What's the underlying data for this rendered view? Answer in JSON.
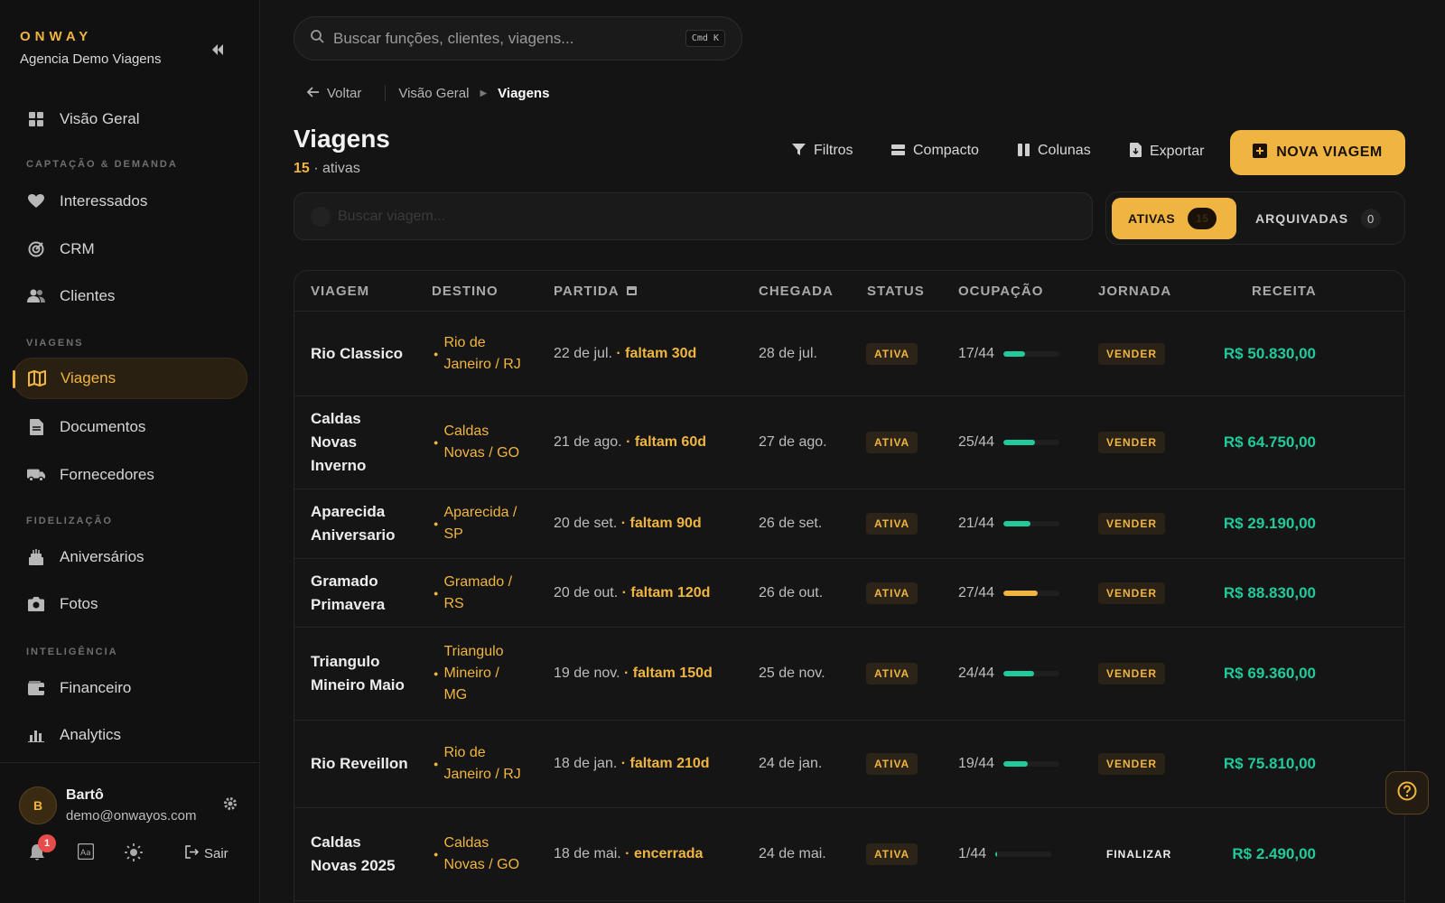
{
  "brand": {
    "name": "ONWAY",
    "agency": "Agencia Demo Viagens"
  },
  "nav": {
    "overview": "Visão Geral",
    "section_capture": "CAPTAÇÃO & DEMANDA",
    "interessados": "Interessados",
    "crm": "CRM",
    "clientes": "Clientes",
    "section_viagens": "VIAGENS",
    "viagens": "Viagens",
    "documentos": "Documentos",
    "fornecedores": "Fornecedores",
    "section_fidelizacao": "FIDELIZAÇÃO",
    "aniversarios": "Aniversários",
    "fotos": "Fotos",
    "section_inteligencia": "INTELIGÊNCIA",
    "financeiro": "Financeiro",
    "analytics": "Analytics"
  },
  "user": {
    "initial": "B",
    "name": "Bartô",
    "email": "demo@onwayos.com",
    "notifications": "1",
    "logout": "Sair"
  },
  "search": {
    "placeholder": "Buscar funções, clientes, viagens...",
    "shortcut": "Cmd K"
  },
  "breadcrumb": {
    "back": "Voltar",
    "parent": "Visão Geral",
    "current": "Viagens"
  },
  "page": {
    "title": "Viagens",
    "active_count": "15",
    "active_label": "· ativas"
  },
  "toolbar": {
    "filters": "Filtros",
    "compact": "Compacto",
    "columns": "Colunas",
    "export": "Exportar",
    "new_trip": "NOVA VIAGEM"
  },
  "trip_search": {
    "placeholder": "Buscar viagem..."
  },
  "segments": {
    "active_label": "ATIVAS",
    "active_count": "15",
    "archived_label": "ARQUIVADAS",
    "archived_count": "0"
  },
  "table": {
    "headers": [
      "VIAGEM",
      "DESTINO",
      "PARTIDA",
      "CHEGADA",
      "STATUS",
      "OCUPAÇÃO",
      "JORNADA",
      "RECEITA"
    ],
    "rows": [
      {
        "trip": "Rio Classico",
        "dest": "Rio de Janeiro / RJ",
        "depart": "22 de jul.",
        "remaining": "· faltam 30d",
        "arrive": "28 de jul.",
        "status": "ATIVA",
        "occ": "17/44",
        "occ_fraction": 0.386,
        "bar_color": "#22c99a",
        "journey": "VENDER",
        "revenue": "R$ 50.830,00"
      },
      {
        "trip": "Caldas Novas Inverno",
        "dest": "Caldas Novas / GO",
        "depart": "21 de ago.",
        "remaining": "· faltam 60d",
        "arrive": "27 de ago.",
        "status": "ATIVA",
        "occ": "25/44",
        "occ_fraction": 0.568,
        "bar_color": "#22c99a",
        "journey": "VENDER",
        "revenue": "R$ 64.750,00"
      },
      {
        "trip": "Aparecida Aniversario",
        "dest": "Aparecida / SP",
        "depart": "20 de set.",
        "remaining": "· faltam 90d",
        "arrive": "26 de set.",
        "status": "ATIVA",
        "occ": "21/44",
        "occ_fraction": 0.477,
        "bar_color": "#22c99a",
        "journey": "VENDER",
        "revenue": "R$ 29.190,00"
      },
      {
        "trip": "Gramado Primavera",
        "dest": "Gramado / RS",
        "depart": "20 de out.",
        "remaining": "· faltam 120d",
        "arrive": "26 de out.",
        "status": "ATIVA",
        "occ": "27/44",
        "occ_fraction": 0.614,
        "bar_color": "#f0b540",
        "journey": "VENDER",
        "revenue": "R$ 88.830,00"
      },
      {
        "trip": "Triangulo Mineiro Maio",
        "dest": "Triangulo Mineiro / MG",
        "depart": "19 de nov.",
        "remaining": "· faltam 150d",
        "arrive": "25 de nov.",
        "status": "ATIVA",
        "occ": "24/44",
        "occ_fraction": 0.545,
        "bar_color": "#22c99a",
        "journey": "VENDER",
        "revenue": "R$ 69.360,00"
      },
      {
        "trip": "Rio Reveillon",
        "dest": "Rio de Janeiro / RJ",
        "depart": "18 de jan.",
        "remaining": "· faltam 210d",
        "arrive": "24 de jan.",
        "status": "ATIVA",
        "occ": "19/44",
        "occ_fraction": 0.432,
        "bar_color": "#22c99a",
        "journey": "VENDER",
        "revenue": "R$ 75.810,00"
      },
      {
        "trip": "Caldas Novas 2025",
        "dest": "Caldas Novas / GO",
        "depart": "18 de mai.",
        "remaining": "· encerrada",
        "arrive": "24 de mai.",
        "status": "ATIVA",
        "occ": "1/44",
        "occ_fraction": 0.023,
        "bar_color": "#22c99a",
        "journey": "FINALIZAR",
        "revenue": "R$ 2.490,00"
      }
    ]
  }
}
